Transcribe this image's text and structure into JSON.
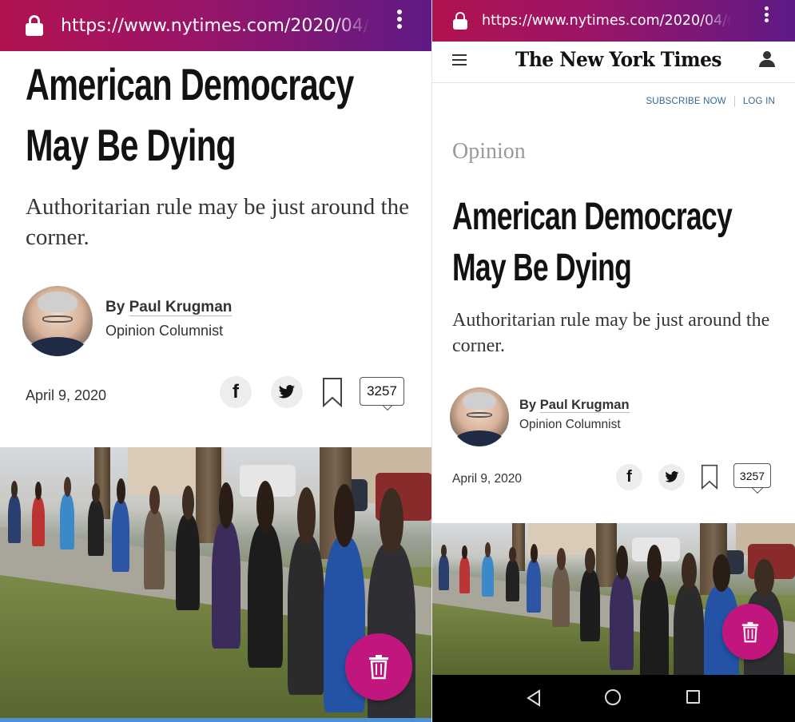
{
  "browser": {
    "url": "https://www.nytimes.com/2020/04/0",
    "gradient_start": "#b1124f",
    "gradient_end": "#5e1a86"
  },
  "masthead": {
    "logo": "The New York Times",
    "subscribe": "SUBSCRIBE NOW",
    "login": "LOG IN"
  },
  "article": {
    "kicker": "Opinion",
    "headline_line1": "American Democracy",
    "headline_line2": "May Be Dying",
    "summary": "Authoritarian rule may be just around the corner.",
    "byline_prefix": "By",
    "author": "Paul Krugman",
    "role": "Opinion Columnist",
    "date": "April 9, 2020",
    "comment_count": "3257"
  },
  "share": {
    "facebook_glyph": "f"
  },
  "colors": {
    "fab": "#c2167f",
    "link": "#326891",
    "kicker": "#999999"
  },
  "icons": [
    "lock-icon",
    "more-vert-icon",
    "menu-icon",
    "user-icon",
    "facebook-icon",
    "twitter-icon",
    "bookmark-icon",
    "comment-icon",
    "trash-icon",
    "back-icon",
    "home-icon",
    "recents-icon"
  ]
}
